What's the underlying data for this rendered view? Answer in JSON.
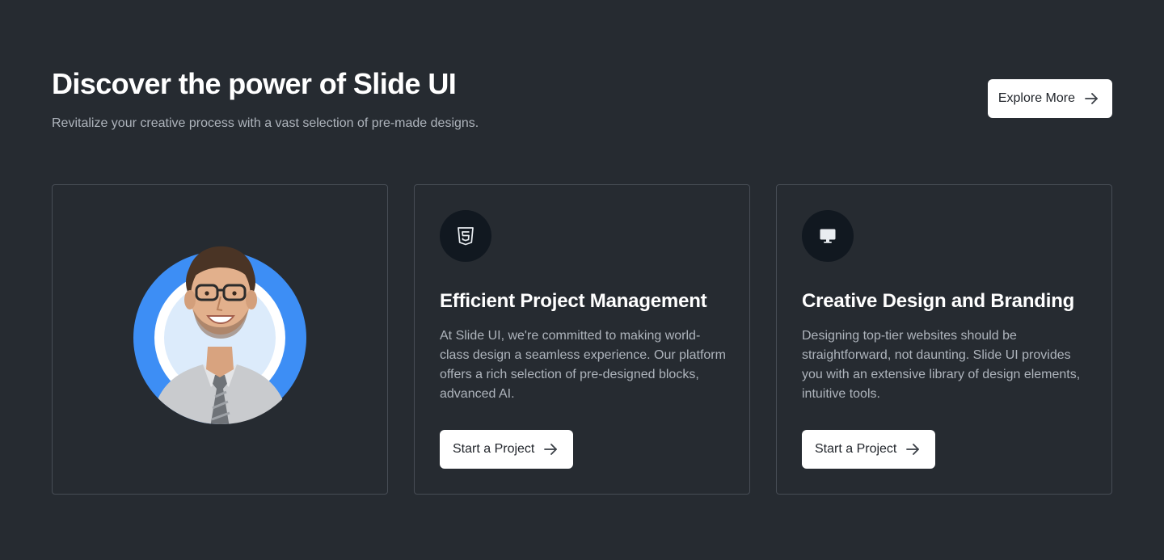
{
  "header": {
    "title": "Discover the power of Slide UI",
    "subtitle": "Revitalize your creative process with a vast selection of pre-made designs.",
    "explore_label": "Explore More"
  },
  "cards": [
    {
      "image": "person-portrait"
    },
    {
      "icon": "html5-icon",
      "title": "Efficient Project Management",
      "text": "At Slide UI, we're committed to making world-class design a seamless experience. Our platform offers a rich selection of pre-designed blocks, advanced AI.",
      "button_label": "Start a Project"
    },
    {
      "icon": "monitor-icon",
      "title": "Creative Design and Branding",
      "text": "Designing top-tier websites should be straightforward, not daunting. Slide UI provides you with an extensive library of design elements, intuitive tools.",
      "button_label": "Start a Project"
    }
  ],
  "colors": {
    "background": "#262b31",
    "card_border": "#474d55",
    "accent_blue": "#3d8ef5",
    "icon_circle": "#111820",
    "muted_text": "#aeb4bc",
    "button_bg": "#ffffff"
  }
}
